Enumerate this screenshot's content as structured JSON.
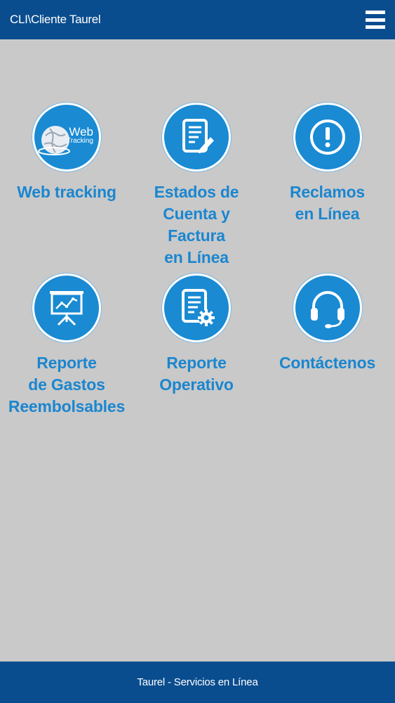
{
  "header": {
    "title": "CLI\\Cliente Taurel",
    "menu_icon": "hamburger-menu-icon"
  },
  "tiles": [
    {
      "label": "Web tracking",
      "icon": "web-tracking-globe-icon",
      "icon_text_main": "Web",
      "icon_text_sub": "Tracking"
    },
    {
      "label": "Estados de\nCuenta y Factura\nen Línea",
      "icon": "document-edit-icon"
    },
    {
      "label": "Reclamos\nen Línea",
      "icon": "exclamation-icon"
    },
    {
      "label": "Reporte\nde Gastos\nReembolsables",
      "icon": "presentation-chart-icon"
    },
    {
      "label": "Reporte\nOperativo",
      "icon": "document-settings-icon"
    },
    {
      "label": "Contáctenos",
      "icon": "headset-icon"
    }
  ],
  "footer": {
    "text": "Taurel - Servicios en Línea"
  },
  "colors": {
    "header_bg": "#0a4d8f",
    "background": "#c9c9c9",
    "accent": "#1a8ad3",
    "label": "#1b86cf"
  }
}
